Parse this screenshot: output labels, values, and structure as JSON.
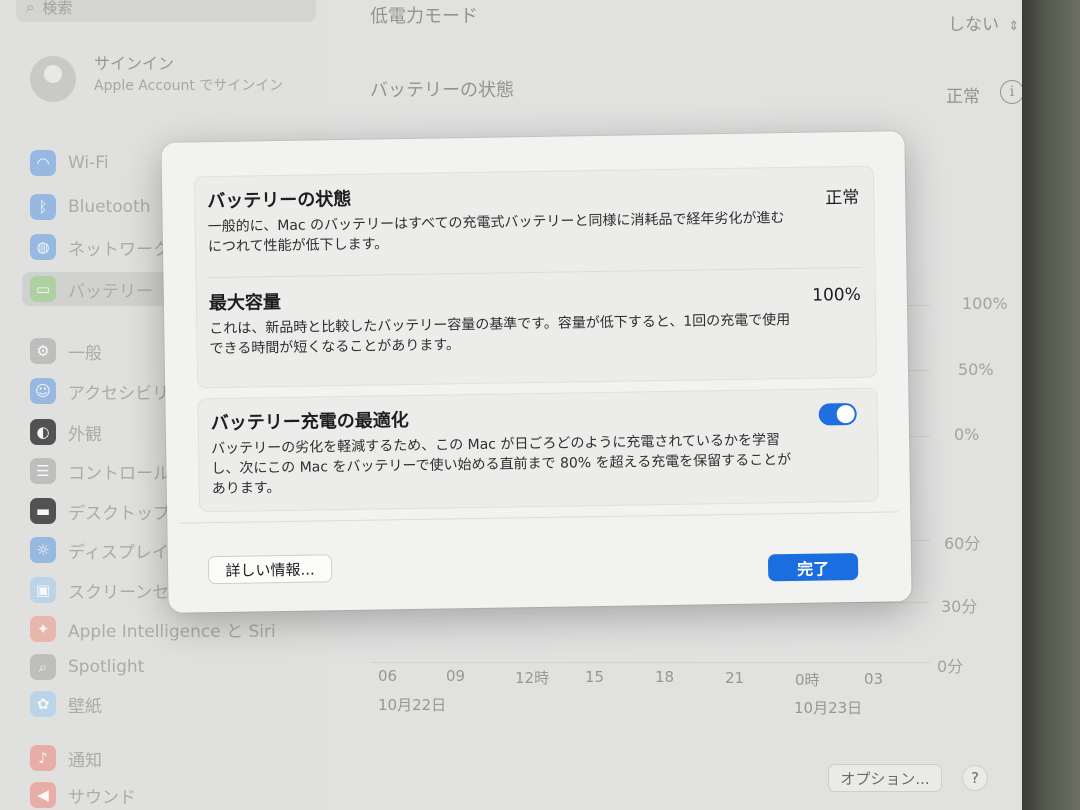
{
  "sidebar": {
    "search_placeholder": "検索",
    "account": {
      "name": "サインイン",
      "subtitle": "Apple Account でサインイン"
    },
    "items": [
      {
        "label": "Wi-Fi",
        "icon": "wifi-icon",
        "color": "#5a9be8"
      },
      {
        "label": "Bluetooth",
        "icon": "bluetooth-icon",
        "color": "#5a9be8"
      },
      {
        "label": "ネットワーク",
        "icon": "globe-icon",
        "color": "#5a9be8"
      },
      {
        "label": "バッテリー",
        "icon": "battery-icon",
        "color": "#7cc46a"
      },
      {
        "label": "一般",
        "icon": "gear-icon",
        "color": "#9a9a98"
      },
      {
        "label": "アクセシビリティ",
        "icon": "accessibility-icon",
        "color": "#5a9be8"
      },
      {
        "label": "外観",
        "icon": "appearance-icon",
        "color": "#3a3a3a"
      },
      {
        "label": "コントロールセンター",
        "icon": "control-center-icon",
        "color": "#9a9a98"
      },
      {
        "label": "デスクトップとDock",
        "icon": "desktop-icon",
        "color": "#3a3a3a"
      },
      {
        "label": "ディスプレイ",
        "icon": "display-icon",
        "color": "#5a9be8"
      },
      {
        "label": "スクリーンセーバ",
        "icon": "screensaver-icon",
        "color": "#8cc0e8"
      },
      {
        "label": "Apple Intelligence と Siri",
        "icon": "siri-icon",
        "color": "#e87a6a"
      },
      {
        "label": "Spotlight",
        "icon": "spotlight-icon",
        "color": "#9a9a98"
      },
      {
        "label": "壁紙",
        "icon": "wallpaper-icon",
        "color": "#8cc0e8"
      },
      {
        "label": "通知",
        "icon": "bell-icon",
        "color": "#e86a5a"
      },
      {
        "label": "サウンド",
        "icon": "sound-icon",
        "color": "#e86a5a"
      }
    ]
  },
  "main": {
    "low_power": {
      "label": "低電力モード",
      "value": "しない"
    },
    "battery_health": {
      "label": "バッテリーの状態",
      "value": "正常"
    },
    "chart": {
      "y_labels_level": [
        "100%",
        "50%",
        "0%"
      ],
      "y_labels_time": [
        "60分",
        "30分",
        "0分"
      ],
      "x_labels": [
        "06",
        "09",
        "12時",
        "15",
        "18",
        "21",
        "0時",
        "03"
      ],
      "dates": [
        "10月22日",
        "10月23日"
      ],
      "partial_label": "3"
    },
    "options_label": "オプション...",
    "help_label": "?"
  },
  "modal": {
    "health": {
      "title": "バッテリーの状態",
      "value": "正常",
      "desc": "一般的に、Mac のバッテリーはすべての充電式バッテリーと同様に消耗品で経年劣化が進むにつれて性能が低下します。"
    },
    "capacity": {
      "title": "最大容量",
      "value": "100%",
      "desc": "これは、新品時と比較したバッテリー容量の基準です。容量が低下すると、1回の充電で使用できる時間が短くなることがあります。"
    },
    "optimize": {
      "title": "バッテリー充電の最適化",
      "enabled": true,
      "desc": "バッテリーの劣化を軽減するため、この Mac が日ごろどのように充電されているかを学習し、次にこの Mac をバッテリーで使い始める直前まで 80% を超える充電を保留することがあります。"
    },
    "details_button": "詳しい情報...",
    "done_button": "完了",
    "accent_color": "#1b6ee0"
  }
}
